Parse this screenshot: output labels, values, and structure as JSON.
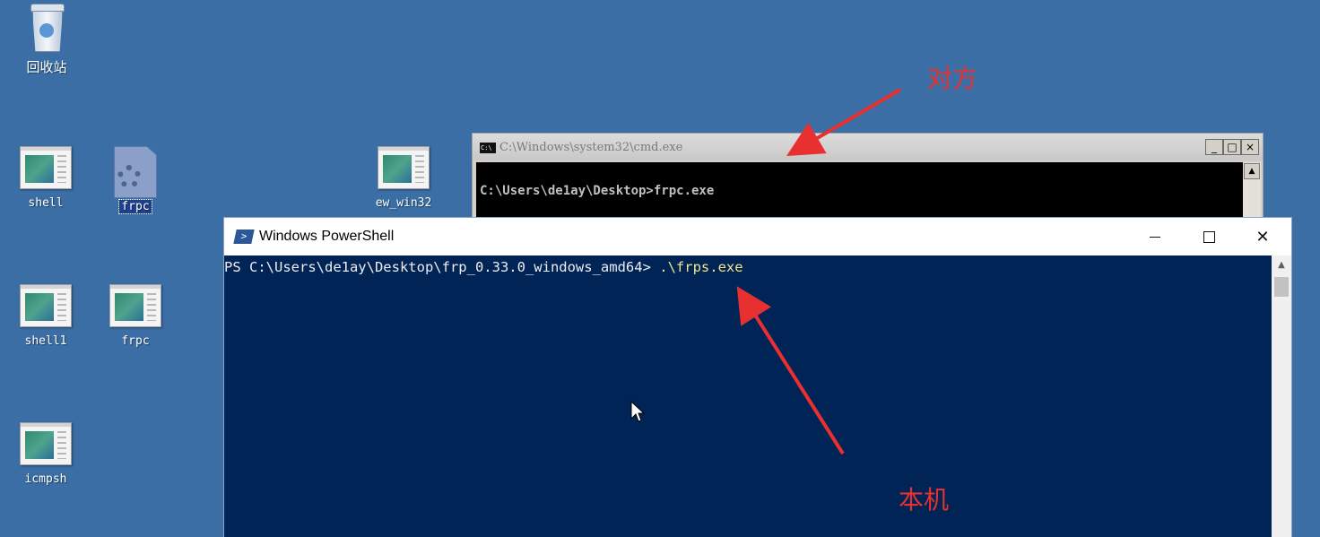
{
  "desktop": {
    "icons": [
      {
        "label": "回收站",
        "icon": "recycle-bin-icon"
      },
      {
        "label": "shell",
        "icon": "application-icon"
      },
      {
        "label": "frpc",
        "icon": "gear-file-icon",
        "selected": true
      },
      {
        "label": "ew_win32",
        "icon": "application-icon"
      },
      {
        "label": "shell1",
        "icon": "application-icon"
      },
      {
        "label": "frpc",
        "icon": "application-icon"
      },
      {
        "label": "icmpsh",
        "icon": "application-icon"
      }
    ]
  },
  "cmd_window": {
    "title": "C:\\Windows\\system32\\cmd.exe",
    "icon_text": "C:\\",
    "line": "C:\\Users\\de1ay\\Desktop>frpc.exe",
    "buttons": {
      "minimize": "_",
      "maximize": "□",
      "close": "×"
    }
  },
  "powershell_window": {
    "title": "Windows PowerShell",
    "prompt": "PS C:\\Users\\de1ay\\Desktop\\frp_0.33.0_windows_amd64> ",
    "command": ".\\frps.exe",
    "close_glyph": "✕"
  },
  "annotations": {
    "remote": "对方",
    "local": "本机",
    "color": "#e83030"
  },
  "colors": {
    "desktop_bg": "#3a6ea5",
    "powershell_bg": "#012456",
    "cmd_bg": "#000000"
  }
}
